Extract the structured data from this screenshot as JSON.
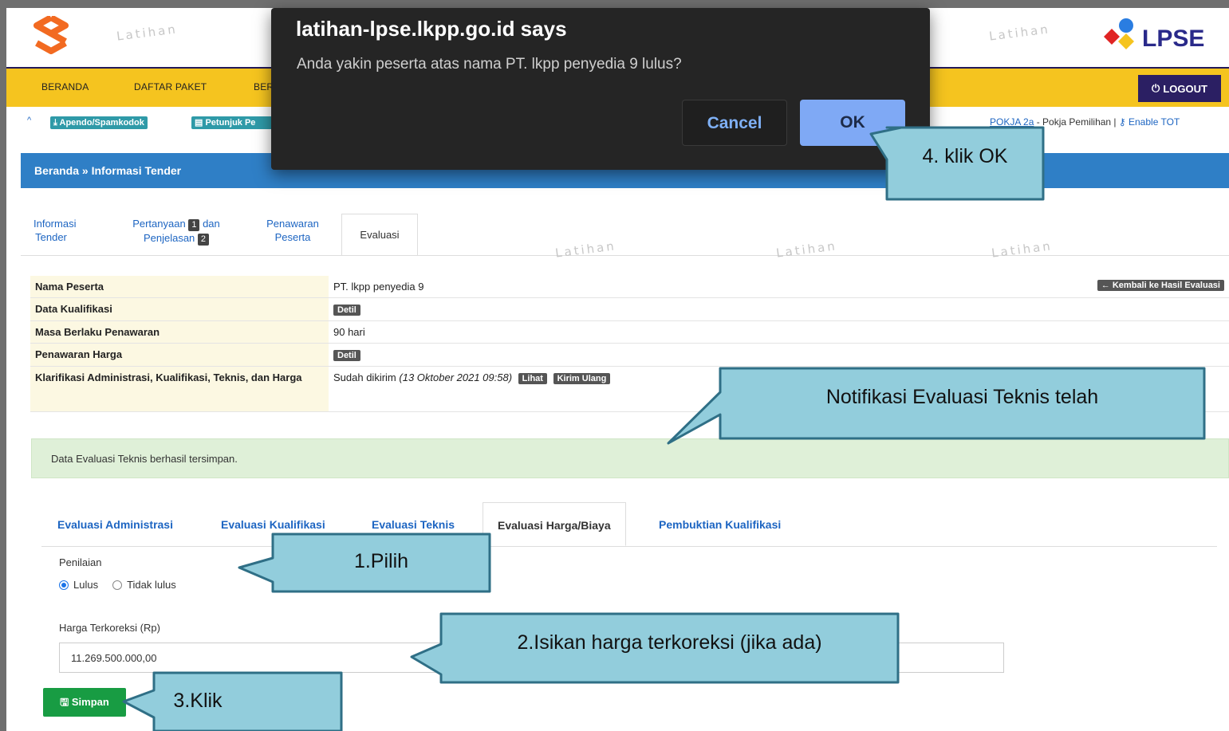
{
  "header": {
    "watermark": "Latihan",
    "logo_text": "LPSE"
  },
  "nav": {
    "items": [
      "BERANDA",
      "DAFTAR PAKET",
      "BER"
    ],
    "logout": "LOGOUT"
  },
  "toolbar": {
    "apendo": "Apendo/Spamkodok",
    "petunjuk": "Petunjuk Pe",
    "pokja_link": "POKJA 2a",
    "pokja_role": " - Pokja Pemilihan | ",
    "enable": "Enable TOT"
  },
  "breadcrumb": "Beranda » Informasi Tender",
  "tabs": {
    "informasi": [
      "Informasi",
      "Tender"
    ],
    "pertanyaan": [
      "Pertanyaan",
      "1",
      "dan",
      "Penjelasan",
      "2"
    ],
    "penawaran": [
      "Penawaran",
      "Peserta"
    ],
    "evaluasi": "Evaluasi"
  },
  "info": {
    "rows": [
      {
        "label": "Nama Peserta",
        "value": "PT. lkpp penyedia 9"
      },
      {
        "label": "Data Kualifikasi",
        "button": "Detil"
      },
      {
        "label": "Masa Berlaku Penawaran",
        "value": "90 hari"
      },
      {
        "label": "Penawaran Harga",
        "button": "Detil"
      },
      {
        "label": "Klarifikasi Administrasi, Kualifikasi, Teknis, dan Harga",
        "value": "Sudah dikirim",
        "date": "(13 Oktober 2021 09:58)",
        "buttons": [
          "Lihat",
          "Kirim Ulang"
        ]
      }
    ],
    "back_button": "Kembali ke Hasil Evaluasi"
  },
  "alert": "Data Evaluasi Teknis berhasil tersimpan.",
  "subtabs": [
    "Evaluasi Administrasi",
    "Evaluasi Kualifikasi",
    "Evaluasi Teknis",
    "Evaluasi Harga/Biaya",
    "Pembuktian Kualifikasi"
  ],
  "form": {
    "penilaian_label": "Penilaian",
    "lulus": "Lulus",
    "tidak_lulus": "Tidak lulus",
    "harga_label": "Harga Terkoreksi (Rp)",
    "harga_value": "11.269.500.000,00",
    "save": "Simpan"
  },
  "dialog": {
    "title": "latihan-lpse.lkpp.go.id says",
    "message": "Anda yakin peserta atas nama PT. lkpp penyedia 9 lulus?",
    "cancel": "Cancel",
    "ok": "OK"
  },
  "callouts": {
    "step1": "1.Pilih",
    "step2": "2.Isikan harga  terkoreksi (jika ada)",
    "step3": "3.Klik",
    "step4": "4. klik OK",
    "notif": "Notifikasi Evaluasi Teknis telah"
  },
  "colors": {
    "nav": "#f5c41f",
    "breadcrumb": "#2f7fc6",
    "callout": "#92cddc",
    "save": "#189c43"
  }
}
